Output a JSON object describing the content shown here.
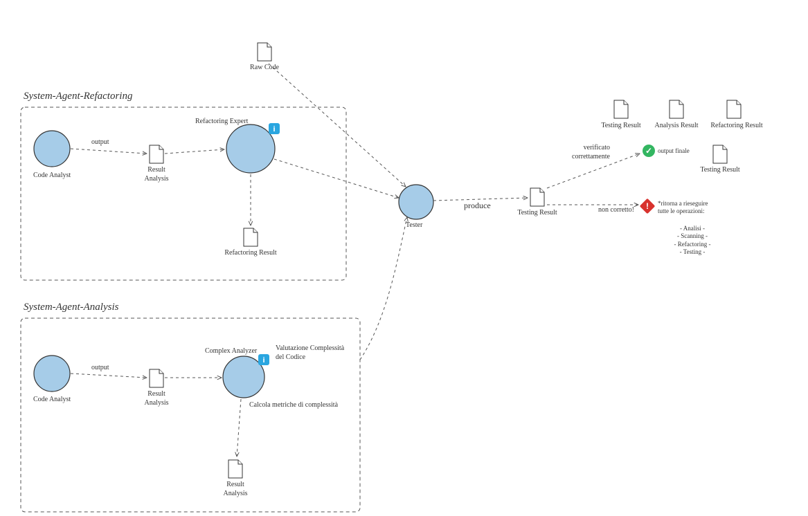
{
  "groups": {
    "refactoring": {
      "title": "System-Agent-Refactoring"
    },
    "analysis": {
      "title": "System-Agent-Analysis"
    }
  },
  "nodes": {
    "raw_code": {
      "label": "Raw Code"
    },
    "code_analyst_top": {
      "label": "Code Analyst"
    },
    "result_analysis_top": {
      "label": "Result\nAnalysis"
    },
    "refactoring_expert": {
      "label": "Refactoring Expert"
    },
    "refactoring_result": {
      "label": "Refactoring Result"
    },
    "code_analyst_bot": {
      "label": "Code Analyst"
    },
    "result_analysis_bot": {
      "label": "Result\nAnalysis"
    },
    "complex_analyzer": {
      "label": "Complex Analyzer",
      "info": "Valutazione Complessità\ndel Codice",
      "sub": "Calcola metriche di complessità"
    },
    "result_analysis_out": {
      "label": "Result\nAnalysis"
    },
    "tester": {
      "label": "Tester"
    },
    "testing_result": {
      "label": "Testing Result"
    },
    "out_testing": {
      "label": "Testing Result"
    },
    "out_analysis": {
      "label": "Analysis Result"
    },
    "out_refactoring": {
      "label": "Refactoring Result"
    },
    "out_testing2": {
      "label": "Testing Result"
    }
  },
  "edges": {
    "output_top": {
      "label": "output"
    },
    "output_bot": {
      "label": "output"
    },
    "produce": {
      "label": "produce"
    },
    "verified": {
      "label": "verificato\ncorrettamente"
    },
    "not_correct": {
      "label": "non corretto!"
    }
  },
  "annotations": {
    "output_finale": "output finale",
    "retry_header": "*ritorna a rieseguire\ntutte le operazioni:",
    "retry_list": "- Analisi -\n- Scanning -\n- Refactoring -\n- Testing -"
  }
}
